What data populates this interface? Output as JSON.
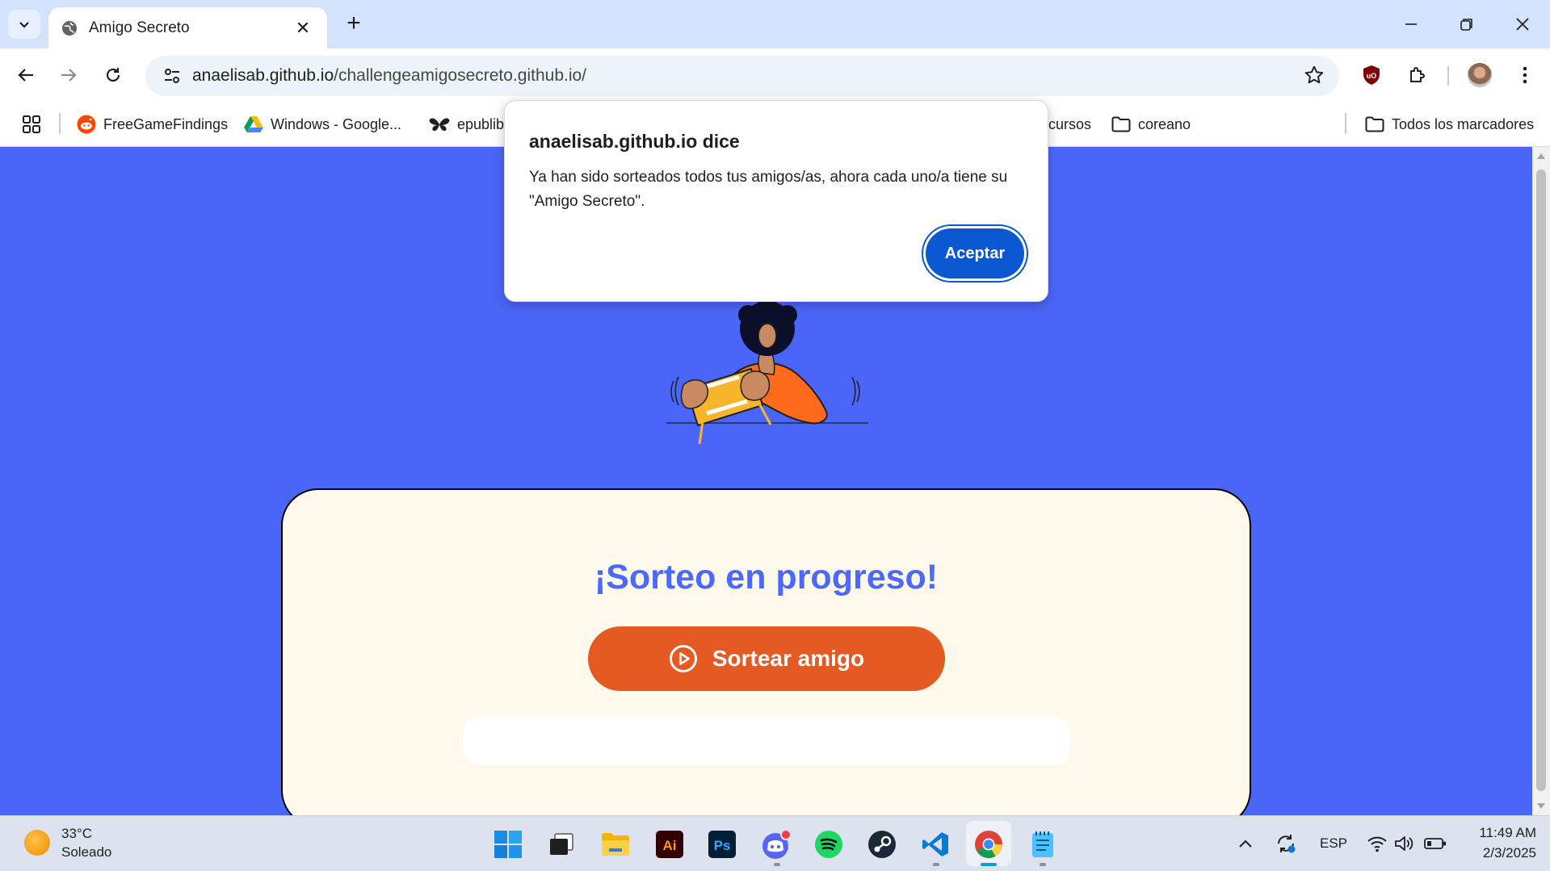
{
  "browser": {
    "tab_title": "Amigo Secreto",
    "url_domain": "anaelisab.github.io",
    "url_path": "/challengeamigosecreto.github.io/"
  },
  "bookmarks": {
    "items": [
      "FreeGameFindings",
      "Windows - Google...",
      "epublib",
      "cursos",
      "coreano"
    ],
    "all_bookmarks": "Todos los marcadores"
  },
  "dialog": {
    "title": "anaelisab.github.io dice",
    "message": "Ya han sido sorteados todos tus amigos/as, ahora cada uno/a tiene su \"Amigo Secreto\".",
    "ok_label": "Aceptar"
  },
  "page": {
    "title": "¡Sorteo en progreso!",
    "draw_button_label": "Sortear amigo",
    "result_text": ""
  },
  "taskbar": {
    "weather_temp": "33°C",
    "weather_desc": "Soleado",
    "language": "ESP",
    "time": "11:49 AM",
    "date": "2/3/2025",
    "apps": [
      "windows-start",
      "task-view",
      "file-explorer",
      "illustrator",
      "photoshop",
      "discord",
      "spotify",
      "steam",
      "vscode",
      "chrome",
      "notepad"
    ]
  },
  "colors": {
    "page_bg": "#4a66f9",
    "card_bg": "#fff9eb",
    "title_color": "#4b69fd",
    "button_orange": "#e55922",
    "dialog_button": "#0b57d0"
  }
}
